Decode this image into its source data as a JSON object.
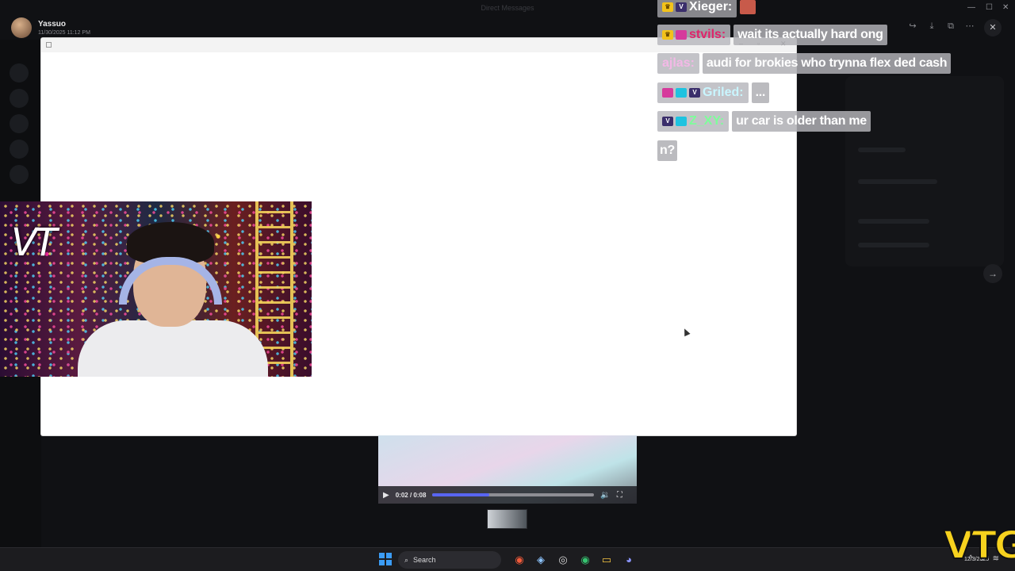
{
  "window": {
    "title": "Direct Messages"
  },
  "message_author": {
    "name": "Yassuo",
    "timestamp": "11/30/2025 11:12 PM"
  },
  "chat": [
    {
      "user": "Xieger:",
      "badges": [
        "crown",
        "vtg"
      ],
      "message": "",
      "emote": true
    },
    {
      "user": "stvils:",
      "badges": [
        "crown",
        "pink"
      ],
      "message": "wait its actually hard ong",
      "name_color": "#e0246b"
    },
    {
      "user": "ajlas:",
      "badges": [],
      "message": "audi for brokies who trynna flex ded cash",
      "name_color": "#f3b8e6"
    },
    {
      "user": "Griled:",
      "badges": [
        "pink",
        "cyan",
        "vtg"
      ],
      "message": "...",
      "name_color": "#c9f6ff"
    },
    {
      "user": "Z_XY:",
      "badges": [
        "vtg",
        "cyan"
      ],
      "message": "ur car is older than me",
      "name_color": "#7dff9a"
    },
    {
      "user": "",
      "badges": [],
      "message": "n?"
    }
  ],
  "player": {
    "time": "0:02 / 0:08",
    "progress": 0.35
  },
  "taskbar": {
    "search_label": "Search",
    "date": "12/3/2025"
  },
  "watermark": "VTG",
  "webcam_logo": "VT",
  "colors": {
    "accent": "#5865f2",
    "watermark": "#f7d21e",
    "taskbar_bg": "#1c1c1f"
  }
}
